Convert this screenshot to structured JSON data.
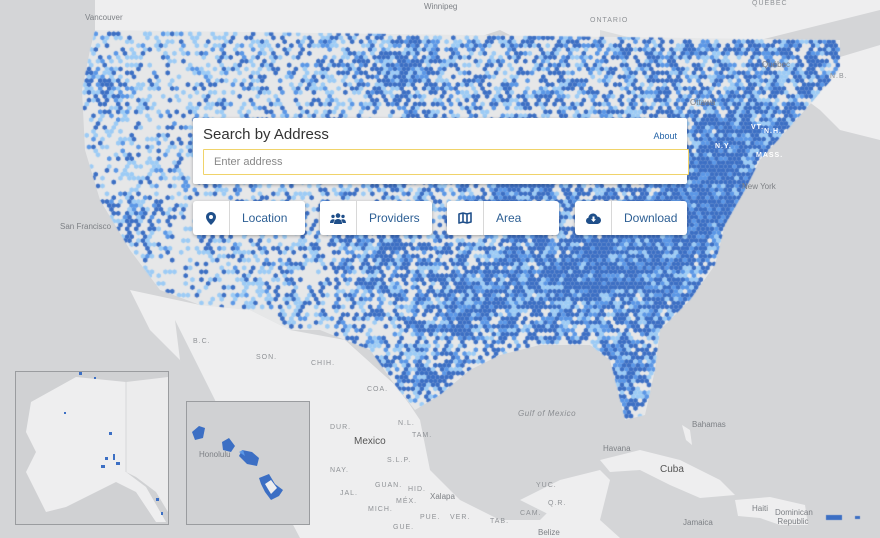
{
  "app": {
    "accent_color": "#1f4f8a",
    "input_border_color": "#f0d36a"
  },
  "search": {
    "title": "Search by Address",
    "about_label": "About",
    "input_value": "",
    "placeholder": "Enter address"
  },
  "toolbar": {
    "buttons": [
      {
        "label": "Location",
        "icon": "map-marker-icon"
      },
      {
        "label": "Providers",
        "icon": "users-icon"
      },
      {
        "label": "Area",
        "icon": "map-icon"
      },
      {
        "label": "Download",
        "icon": "cloud-download-icon"
      }
    ]
  },
  "map": {
    "coverage_colors": {
      "high": "#3c6fc4",
      "medium": "#5b97e6",
      "low": "#9ccbf5",
      "none": "#e4e5e7"
    },
    "place_labels": {
      "vancouver": "Vancouver",
      "winnipeg": "Winnipeg",
      "ontario": "ONTARIO",
      "quebec_province": "QUÉBEC",
      "quebec_city": "Québec",
      "ottawa": "Ottawa",
      "nb": "N.B.",
      "new_york": "New York",
      "san_francisco": "San Francisco",
      "son": "SON.",
      "chih": "CHIH.",
      "bc": "B.C.",
      "coa": "COA.",
      "nl": "N.L.",
      "dur": "DUR.",
      "tam": "TAM.",
      "mexico": "Mexico",
      "slp": "S.L.P.",
      "nay": "NAY.",
      "guan": "GUAN.",
      "hid": "HID.",
      "jal": "JAL.",
      "mex": "MÉX.",
      "xalapa": "Xalapa",
      "mich": "MICH.",
      "pue": "PUE.",
      "ver": "VER.",
      "gue": "GUE.",
      "yuc": "YUC.",
      "qr": "Q.R.",
      "cam": "CAM.",
      "tab": "TAB.",
      "belize": "Belize",
      "gulf": "Gulf of Mexico",
      "havana": "Havana",
      "bahamas": "Bahamas",
      "cuba": "Cuba",
      "haiti": "Haiti",
      "dominican_republic": "Dominican Republic",
      "jamaica": "Jamaica",
      "honolulu": "Honolulu",
      "new_york_state": "N.Y.",
      "mass": "MASS.",
      "vt": "VT.",
      "nh": "N.H."
    }
  }
}
